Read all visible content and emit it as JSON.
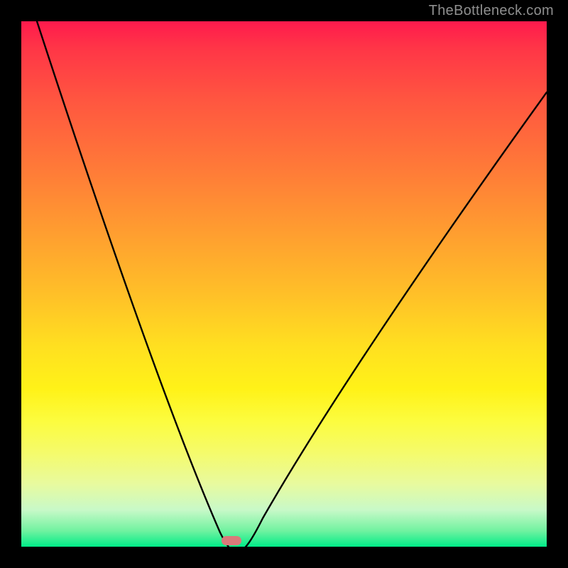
{
  "watermark": "TheBottleneck.com",
  "chart_data": {
    "type": "line",
    "title": "",
    "xlabel": "",
    "ylabel": "",
    "xlim": [
      0,
      100
    ],
    "ylim": [
      0,
      100
    ],
    "grid": false,
    "legend": false,
    "series": [
      {
        "name": "bottleneck-curve",
        "x": [
          3,
          6,
          10,
          15,
          20,
          25,
          30,
          34,
          37,
          39,
          40,
          41,
          43,
          46,
          50,
          55,
          62,
          70,
          80,
          90,
          100
        ],
        "values": [
          100,
          90,
          78,
          64,
          50,
          37,
          24,
          13,
          6,
          1.5,
          0.5,
          1.5,
          6,
          14,
          24,
          36,
          50,
          62,
          73,
          81,
          87
        ]
      }
    ],
    "marker": {
      "x": 40,
      "y": 0
    },
    "gradient_stops": [
      {
        "pos": 0,
        "color": "#ff1a4d"
      },
      {
        "pos": 50,
        "color": "#ffc028"
      },
      {
        "pos": 75,
        "color": "#fcfc3e"
      },
      {
        "pos": 100,
        "color": "#00ec88"
      }
    ]
  }
}
